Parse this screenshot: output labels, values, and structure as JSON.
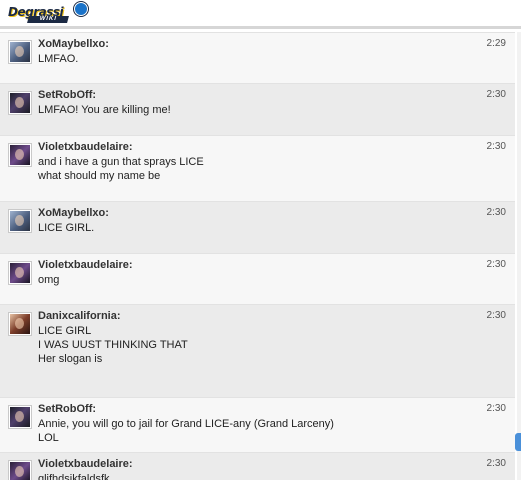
{
  "app": {
    "logo_text": "Degrassi",
    "logo_sub": "WIKI"
  },
  "messages": [
    {
      "user": "XoMaybellxo:",
      "time": "2:29",
      "lines": [
        "LMFAO."
      ],
      "avatar": "a-blue"
    },
    {
      "user": "SetRobOff:",
      "time": "2:30",
      "lines": [
        "LMFAO! You are killing me!"
      ],
      "avatar": "a-dark"
    },
    {
      "user": "Violetxbaudelaire:",
      "time": "2:30",
      "lines": [
        "and i have a gun that sprays LICE",
        "what should my name be"
      ],
      "avatar": "a-purple"
    },
    {
      "user": "XoMaybellxo:",
      "time": "2:30",
      "lines": [
        "LICE GIRL."
      ],
      "avatar": "a-blue"
    },
    {
      "user": "Violetxbaudelaire:",
      "time": "2:30",
      "lines": [
        "omg"
      ],
      "avatar": "a-purple"
    },
    {
      "user": "Danixcalifornia:",
      "time": "2:30",
      "lines": [
        "LICE GIRL",
        "I WAS UUST THINKING THAT",
        "Her slogan is"
      ],
      "avatar": "a-warm"
    },
    {
      "user": "SetRobOff:",
      "time": "2:30",
      "lines": [
        "Annie, you will go to jail for Grand LICE-any (Grand Larceny)",
        "LOL"
      ],
      "avatar": "a-dark"
    },
    {
      "user": "Violetxbaudelaire:",
      "time": "2:30",
      "lines": [
        "qljfhdsjkfaldsfk"
      ],
      "avatar": "a-purple"
    }
  ]
}
